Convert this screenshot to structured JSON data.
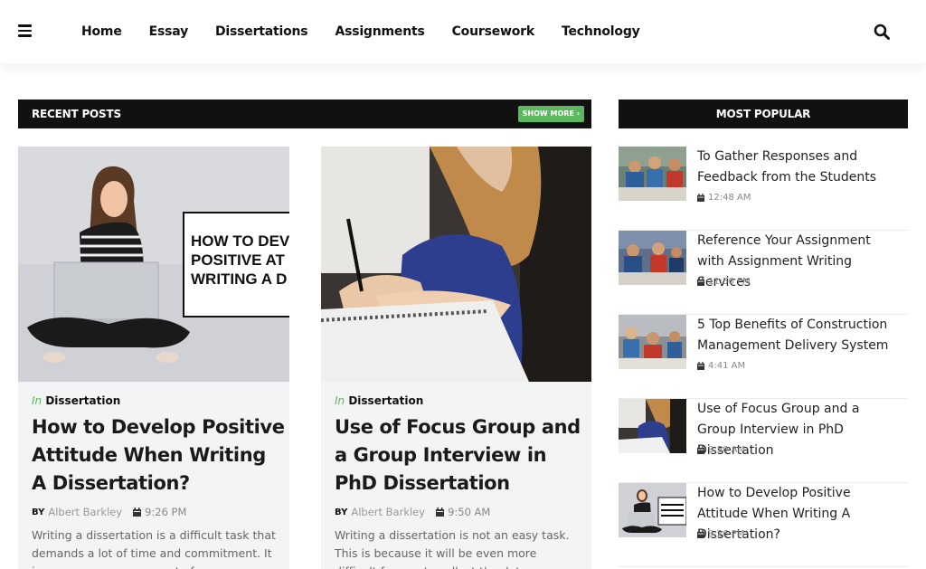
{
  "nav": {
    "items": [
      "Home",
      "Essay",
      "Dissertations",
      "Assignments",
      "Coursework",
      "Technology"
    ]
  },
  "recent": {
    "heading": "RECENT POSTS",
    "show_more": "SHOW MORE ›",
    "cards": [
      {
        "cat_prefix": "In",
        "category": "Dissertation",
        "title": "How to Develop Positive Attitude When Writing A Dissertation?",
        "by": "BY",
        "author": "Albert Barkley",
        "time": "9:26 PM",
        "excerpt": "Writing a dissertation is a difficult task that demands a lot of time and commitment. It is a necessary component of a",
        "image_text": "HOW TO DEV POSITIVE AT WRITING A D"
      },
      {
        "cat_prefix": "In",
        "category": "Dissertation",
        "title": "Use of Focus Group and a Group Interview in PhD Dissertation",
        "by": "BY",
        "author": "Albert Barkley",
        "time": "9:50 AM",
        "excerpt": "Writing a dissertation is not an easy task. This is because it will be even more difficult for you to collect the data"
      }
    ]
  },
  "popular": {
    "heading": "MOST POPULAR",
    "items": [
      {
        "title": "To Gather Responses and Feedback from the Students",
        "time": "12:48 AM"
      },
      {
        "title": "Reference Your Assignment with Assignment Writing Services",
        "time": "11:50 PM"
      },
      {
        "title": "5 Top Benefits of Construction Management Delivery System",
        "time": "4:41 AM"
      },
      {
        "title": "Use of Focus Group and a Group Interview in PhD Dissertation",
        "time": "9:50 AM"
      },
      {
        "title": "How to Develop Positive Attitude When Writing A Dissertation?",
        "time": "9:26 PM"
      }
    ]
  },
  "colors": {
    "accent_green": "#5cb85c",
    "header_black": "#111111",
    "card_bg": "#f3f4f6"
  },
  "icons": [
    "hamburger-menu-icon",
    "search-icon",
    "calendar-icon",
    "chevron-right-icon"
  ]
}
